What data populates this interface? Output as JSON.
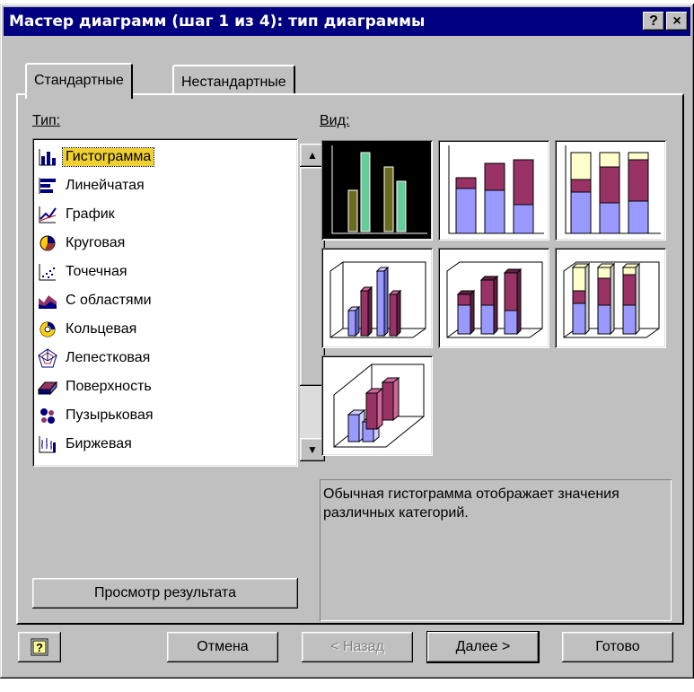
{
  "window": {
    "title": "Мастер диаграмм (шаг 1 из 4): тип диаграммы",
    "help_button": "?",
    "close_button": "×"
  },
  "tabs": [
    {
      "label": "Стандартные",
      "active": true
    },
    {
      "label": "Нестандартные",
      "active": false
    }
  ],
  "type_section": {
    "label": "Тип:",
    "items": [
      {
        "label": "Гистограмма",
        "icon": "column-chart-icon",
        "selected": true
      },
      {
        "label": "Линейчатая",
        "icon": "bar-chart-icon"
      },
      {
        "label": "График",
        "icon": "line-chart-icon"
      },
      {
        "label": "Круговая",
        "icon": "pie-chart-icon"
      },
      {
        "label": "Точечная",
        "icon": "scatter-chart-icon"
      },
      {
        "label": "С областями",
        "icon": "area-chart-icon"
      },
      {
        "label": "Кольцевая",
        "icon": "doughnut-chart-icon"
      },
      {
        "label": "Лепестковая",
        "icon": "radar-chart-icon"
      },
      {
        "label": "Поверхность",
        "icon": "surface-chart-icon"
      },
      {
        "label": "Пузырьковая",
        "icon": "bubble-chart-icon"
      },
      {
        "label": "Биржевая",
        "icon": "stock-chart-icon"
      }
    ]
  },
  "view_section": {
    "label": "Вид:",
    "subtypes": [
      {
        "name": "clustered-column",
        "selected": true
      },
      {
        "name": "stacked-column"
      },
      {
        "name": "100-stacked-column"
      },
      {
        "name": "3d-clustered-column"
      },
      {
        "name": "3d-stacked-column"
      },
      {
        "name": "3d-100-stacked-column"
      },
      {
        "name": "3d-column"
      }
    ]
  },
  "description": "Обычная гистограмма отображает значения различных категорий.",
  "preview_button": "Просмотр результата",
  "buttons": {
    "help": "?",
    "cancel": "Отмена",
    "back": "< Назад",
    "next": "Далее >",
    "finish": "Готово"
  },
  "colors": {
    "title_bar": "#000080",
    "dialog_bg": "#c0c0c0",
    "selection": "#f0d030",
    "series_blue": "#9999ff",
    "series_plum": "#993366",
    "series_cream": "#ffffcc",
    "selected_bar_olive": "#6b6b1f",
    "selected_bar_teal": "#66cc99"
  }
}
